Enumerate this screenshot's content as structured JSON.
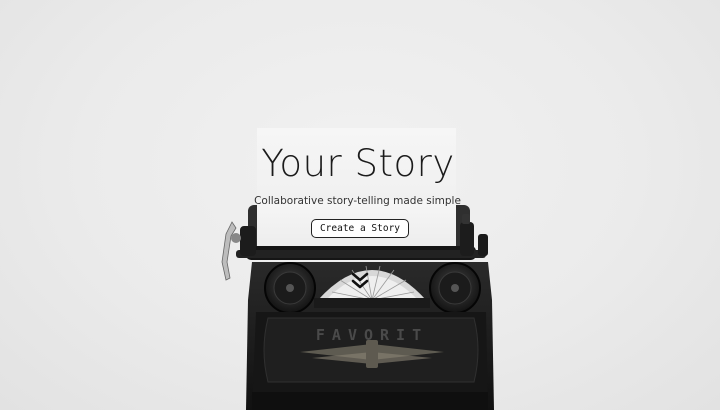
{
  "hero": {
    "title": "Your Story",
    "subtitle": "Collaborative story-telling made simple",
    "cta_label": "Create a Story",
    "typewriter_brand": "FAVORIT"
  },
  "icons": {
    "scroll": "double-chevron-down-icon"
  }
}
